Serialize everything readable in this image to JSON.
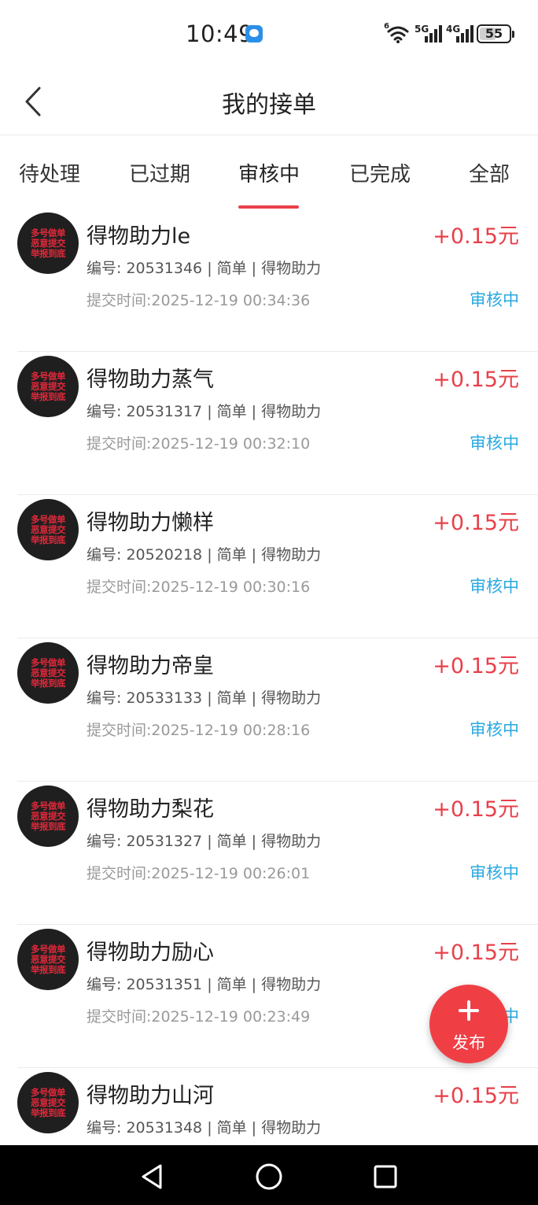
{
  "status_bar": {
    "time": "10:49",
    "wifi_label": "6",
    "sim1_label": "5G",
    "sim2_label": "4G",
    "battery_level": 55,
    "battery_text": "55"
  },
  "header": {
    "title": "我的接单"
  },
  "tabs": [
    {
      "label": "待处理",
      "active": false
    },
    {
      "label": "已过期",
      "active": false
    },
    {
      "label": "审核中",
      "active": true
    },
    {
      "label": "已完成",
      "active": false
    },
    {
      "label": "全部",
      "active": false
    }
  ],
  "avatar_text": [
    "多号做单",
    "恶意提交",
    "举报到底"
  ],
  "orders": [
    {
      "title": "得物助力le",
      "reward": "+0.15元",
      "meta": "编号:  20531346 | 简单 | 得物助力",
      "time": "提交时间:2025-12-19 00:34:36",
      "status": "审核中"
    },
    {
      "title": "得物助力蒸气",
      "reward": "+0.15元",
      "meta": "编号:  20531317 | 简单 | 得物助力",
      "time": "提交时间:2025-12-19 00:32:10",
      "status": "审核中"
    },
    {
      "title": "得物助力懒样",
      "reward": "+0.15元",
      "meta": "编号:  20520218 | 简单 | 得物助力",
      "time": "提交时间:2025-12-19 00:30:16",
      "status": "审核中"
    },
    {
      "title": "得物助力帝皇",
      "reward": "+0.15元",
      "meta": "编号:  20533133 | 简单 | 得物助力",
      "time": "提交时间:2025-12-19 00:28:16",
      "status": "审核中"
    },
    {
      "title": "得物助力梨花",
      "reward": "+0.15元",
      "meta": "编号:  20531327 | 简单 | 得物助力",
      "time": "提交时间:2025-12-19 00:26:01",
      "status": "审核中"
    },
    {
      "title": "得物助力励心",
      "reward": "+0.15元",
      "meta": "编号:  20531351 | 简单 | 得物助力",
      "time": "提交时间:2025-12-19 00:23:49",
      "status": "审核中"
    },
    {
      "title": "得物助力山河",
      "reward": "+0.15元",
      "meta": "编号:  20531348 | 简单 | 得物助力",
      "time": "",
      "status": ""
    }
  ],
  "fab": {
    "label": "发布"
  },
  "colors": {
    "accent_red": "#e8404a",
    "status_blue": "#29a9e0",
    "fab_red": "#ef3f45"
  },
  "icons": {
    "back": "chevron-left-icon",
    "fab": "plus-icon",
    "nav_back": "triangle-back-icon",
    "nav_home": "circle-home-icon",
    "nav_recents": "square-recents-icon"
  }
}
